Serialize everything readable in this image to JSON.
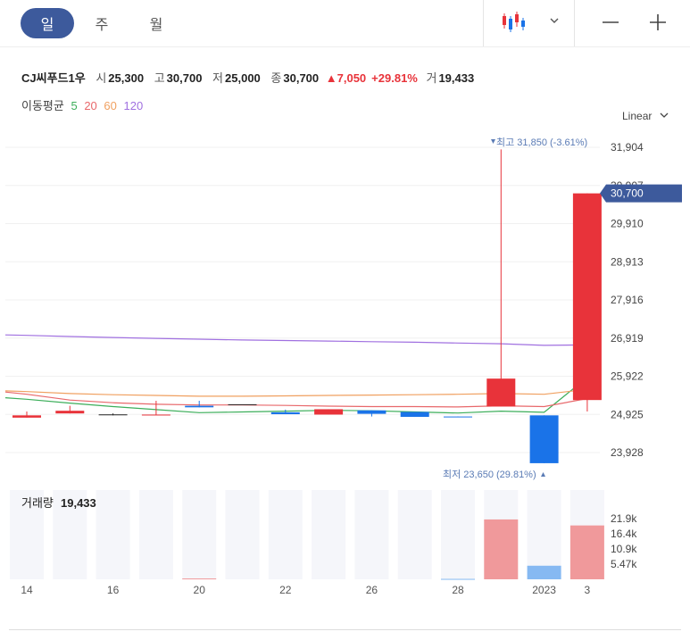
{
  "toolbar": {
    "tabs": [
      {
        "label": "일",
        "active": true
      },
      {
        "label": "주",
        "active": false
      },
      {
        "label": "월",
        "active": false
      }
    ],
    "chart_type_icon": "candlestick-icon",
    "dropdown_icon": "chevron-down-icon",
    "zoom_out_icon": "minus-icon",
    "zoom_in_icon": "plus-icon"
  },
  "stock": {
    "name": "CJ씨푸드1우",
    "open_label": "시",
    "open": "25,300",
    "high_label": "고",
    "high": "30,700",
    "low_label": "저",
    "low": "25,000",
    "close_label": "종",
    "close": "30,700",
    "change": "▲7,050",
    "change_pct": "+29.81%",
    "volume_label": "거",
    "volume": "19,433"
  },
  "moving_average": {
    "label": "이동평균",
    "periods": [
      {
        "label": "5",
        "color": "#3cae5a"
      },
      {
        "label": "20",
        "color": "#e8686b"
      },
      {
        "label": "60",
        "color": "#f0a060"
      },
      {
        "label": "120",
        "color": "#a070e0"
      }
    ]
  },
  "scale_label": "Linear",
  "colors": {
    "up": "#e8333a",
    "down": "#1a73e8",
    "accent": "#3d5a9c"
  },
  "chart_data": {
    "type": "candlestick",
    "price_axis": {
      "ticks": [
        "31,904",
        "30,907",
        "29,910",
        "28,913",
        "27,916",
        "26,919",
        "25,922",
        "24,925",
        "23,928"
      ],
      "tick_values": [
        31904,
        30907,
        29910,
        28913,
        27916,
        26919,
        25922,
        24925,
        23928
      ],
      "current_price_label": "30,700",
      "current_price": 30700
    },
    "x_axis": {
      "ticks": [
        "14",
        "16",
        "20",
        "22",
        "26",
        "28",
        "2023",
        "3"
      ]
    },
    "high_annotation": "최고 31,850 (-3.61%)",
    "low_annotation": "최저 23,650 (29.81%)",
    "candles": [
      {
        "o": 24840,
        "c": 24900,
        "h": 25000,
        "l": 24840
      },
      {
        "o": 24950,
        "c": 25020,
        "h": 25150,
        "l": 24950
      },
      {
        "o": 24925,
        "c": 24925,
        "h": 24950,
        "l": 24900
      },
      {
        "o": 24910,
        "c": 24920,
        "h": 25280,
        "l": 24910
      },
      {
        "o": 25150,
        "c": 25110,
        "h": 25280,
        "l": 25110
      },
      {
        "o": 25190,
        "c": 25190,
        "h": 25190,
        "l": 25190
      },
      {
        "o": 24980,
        "c": 24930,
        "h": 25050,
        "l": 24930
      },
      {
        "o": 24920,
        "c": 25060,
        "h": 25060,
        "l": 24920
      },
      {
        "o": 25030,
        "c": 24940,
        "h": 25030,
        "l": 24870
      },
      {
        "o": 24990,
        "c": 24860,
        "h": 24990,
        "l": 24860
      },
      {
        "o": 24870,
        "c": 24860,
        "h": 24870,
        "l": 24860
      },
      {
        "o": 25130,
        "c": 25860,
        "h": 31850,
        "l": 25130
      },
      {
        "o": 24900,
        "c": 23650,
        "h": 24900,
        "l": 23650
      },
      {
        "o": 25300,
        "c": 30700,
        "h": 30700,
        "l": 25000
      }
    ],
    "moving_averages": [
      {
        "name": "5",
        "color": "#3cae5a",
        "values": [
          25320,
          25220,
          25130,
          25050,
          24970,
          24990,
          25010,
          25030,
          25020,
          24990,
          24960,
          25010,
          24980,
          25890
        ]
      },
      {
        "name": "20",
        "color": "#e8686b",
        "values": [
          25450,
          25300,
          25230,
          25190,
          25170,
          25170,
          25160,
          25140,
          25130,
          25130,
          25120,
          25150,
          25130,
          25340
        ]
      },
      {
        "name": "60",
        "color": "#f0a060",
        "values": [
          25520,
          25470,
          25440,
          25420,
          25400,
          25400,
          25410,
          25420,
          25430,
          25440,
          25450,
          25470,
          25450,
          25580
        ]
      },
      {
        "name": "120",
        "color": "#a070e0",
        "values": [
          26990,
          26960,
          26935,
          26910,
          26890,
          26870,
          26855,
          26840,
          26825,
          26810,
          26790,
          26770,
          26730,
          26740
        ]
      }
    ],
    "volume": {
      "label": "거래량",
      "value": "19,433",
      "ticks": [
        "21.9k",
        "16.4k",
        "10.9k",
        "5.47k"
      ],
      "tick_values": [
        21900,
        16400,
        10900,
        5470
      ],
      "bars": [
        0,
        0,
        0,
        0,
        300,
        0,
        0,
        0,
        0,
        0,
        150,
        21600,
        4900,
        19433
      ],
      "bar_dir": [
        "down",
        "down",
        "down",
        "down",
        "up",
        "down",
        "down",
        "down",
        "down",
        "down",
        "down",
        "up",
        "down",
        "up"
      ]
    }
  }
}
